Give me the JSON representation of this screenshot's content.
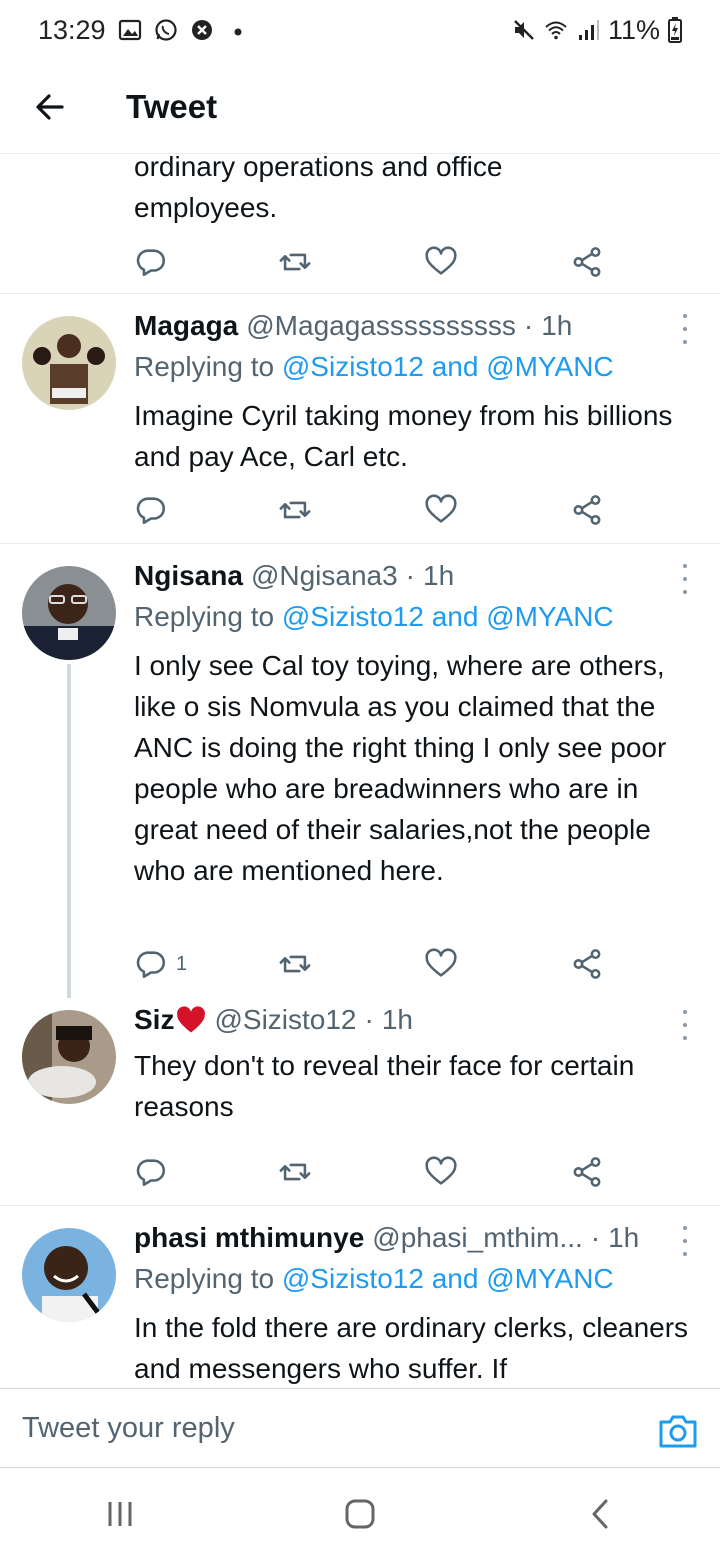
{
  "status_bar": {
    "time": "13:29",
    "battery": "11%",
    "left_icons": [
      "gallery-icon",
      "whatsapp-icon",
      "shield-icon",
      "dot"
    ],
    "right_icons": [
      "mute-icon",
      "wifi-icon",
      "signal-icon",
      "battery-charging-icon"
    ]
  },
  "header": {
    "title": "Tweet",
    "back_icon": "arrow-left-icon"
  },
  "partial_tweet": {
    "text_line1": "ordinary operations and office",
    "text_line2": "employees."
  },
  "tweets": [
    {
      "name": "Magaga",
      "handle": "@Magagassssssssss",
      "time": "1h",
      "replying_prefix": "Replying to",
      "replying_users": "@Sizisto12 and @MYANC",
      "text": "Imagine Cyril taking money from his billions and pay Ace, Carl etc.",
      "reply_count": ""
    },
    {
      "name": "Ngisana",
      "handle": "@Ngisana3",
      "time": "1h",
      "replying_prefix": "Replying to",
      "replying_users": "@Sizisto12 and @MYANC",
      "text": "I only see Cal toy toying, where are others, like o sis Nomvula as you claimed that the ANC is doing the right thing I only see poor people who are breadwinners who are in great need of their salaries,not the people who are mentioned here.",
      "reply_count": "1"
    },
    {
      "name": "Siz",
      "handle": "@Sizisto12",
      "time": "1h",
      "text": "They don't to reveal their face for certain reasons",
      "reply_count": ""
    },
    {
      "name": "phasi mthimunye",
      "handle": "@phasi_mthim...",
      "time": "1h",
      "replying_prefix": "Replying to",
      "replying_users": "@Sizisto12 and @MYANC",
      "text": "In the fold there are ordinary clerks, cleaners and messengers who suffer. If"
    }
  ],
  "reply_bar": {
    "placeholder": "Tweet your reply",
    "camera_icon": "camera-icon"
  },
  "colors": {
    "link": "#1d9bf0",
    "secondary_text": "#536471",
    "primary_text": "#0f1419",
    "heart": "#e0245e",
    "divider": "#e6ecf0"
  }
}
